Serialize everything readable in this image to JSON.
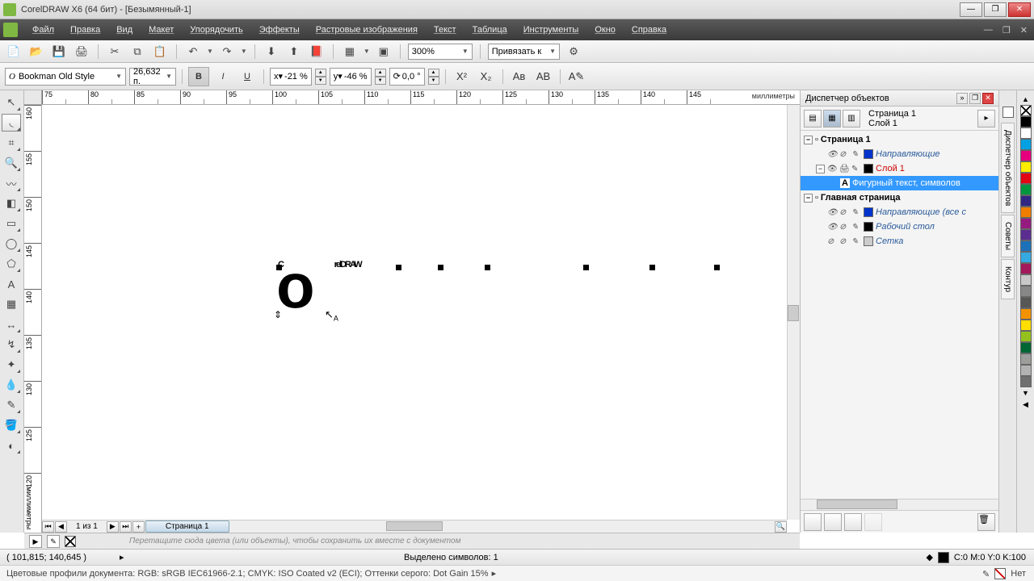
{
  "window": {
    "title": "CorelDRAW X6 (64 бит) - [Безымянный-1]"
  },
  "menu": [
    "Файл",
    "Правка",
    "Вид",
    "Макет",
    "Упорядочить",
    "Эффекты",
    "Растровые изображения",
    "Текст",
    "Таблица",
    "Инструменты",
    "Окно",
    "Справка"
  ],
  "toolbar": {
    "zoom": "300%",
    "snap_to": "Привязать к"
  },
  "propbar": {
    "font": "Bookman Old Style",
    "size": "26,632 п.",
    "hshift_label": "x▾",
    "hshift": "-21 %",
    "vshift_label": "y▾",
    "vshift": "-46 %",
    "rotate": "0,0 °"
  },
  "ruler": {
    "units": "миллиметры",
    "h": [
      "75",
      "80",
      "85",
      "90",
      "95",
      "100",
      "105",
      "110",
      "115",
      "120",
      "125",
      "130",
      "135",
      "140",
      "145"
    ],
    "v": [
      "160",
      "155",
      "150",
      "145",
      "140",
      "135",
      "130",
      "125",
      "120"
    ]
  },
  "canvas_text": {
    "c": "C",
    "o": "o",
    "rest": "relDRAW"
  },
  "pages": {
    "counter": "1 из 1",
    "tab": "Страница 1"
  },
  "docker": {
    "title": "Диспетчер объектов",
    "info_line1": "Страница 1",
    "info_line2": "Слой 1",
    "tree": {
      "page1": "Страница 1",
      "guides": "Направляющие",
      "layer1": "Слой 1",
      "artistic_text": "Фигурный текст, символов",
      "master": "Главная страница",
      "guides_all": "Направляющие (все с",
      "desktop": "Рабочий стол",
      "grid": "Сетка"
    }
  },
  "docker_tabs": [
    "Диспетчер объектов",
    "Советы",
    "Контур"
  ],
  "colorwell_hint": "Перетащите сюда цвета (или объекты), чтобы сохранить их вместе с документом",
  "status": {
    "coords": "( 101,815; 140,645 )",
    "selection": "Выделено символов: 1",
    "fill": "C:0 M:0 Y:0 K:100",
    "outline": "Нет"
  },
  "profiles": "Цветовые профили документа: RGB: sRGB IEC61966-2.1; CMYK: ISO Coated v2 (ECI); Оттенки серого: Dot Gain 15%",
  "palette": [
    "#000000",
    "#ffffff",
    "#00a0e3",
    "#e6007e",
    "#ffed00",
    "#e30613",
    "#009640",
    "#312783",
    "#ef7d00",
    "#951b81",
    "#c8c8c8",
    "#878787",
    "#575756",
    "#9d9d9c",
    "#b2b2b2",
    "#706f6f",
    "#f39200",
    "#36a9e1",
    "#1d71b8",
    "#a3195b",
    "#ffde00",
    "#95c11f",
    "#006633",
    "#5b2d90"
  ]
}
